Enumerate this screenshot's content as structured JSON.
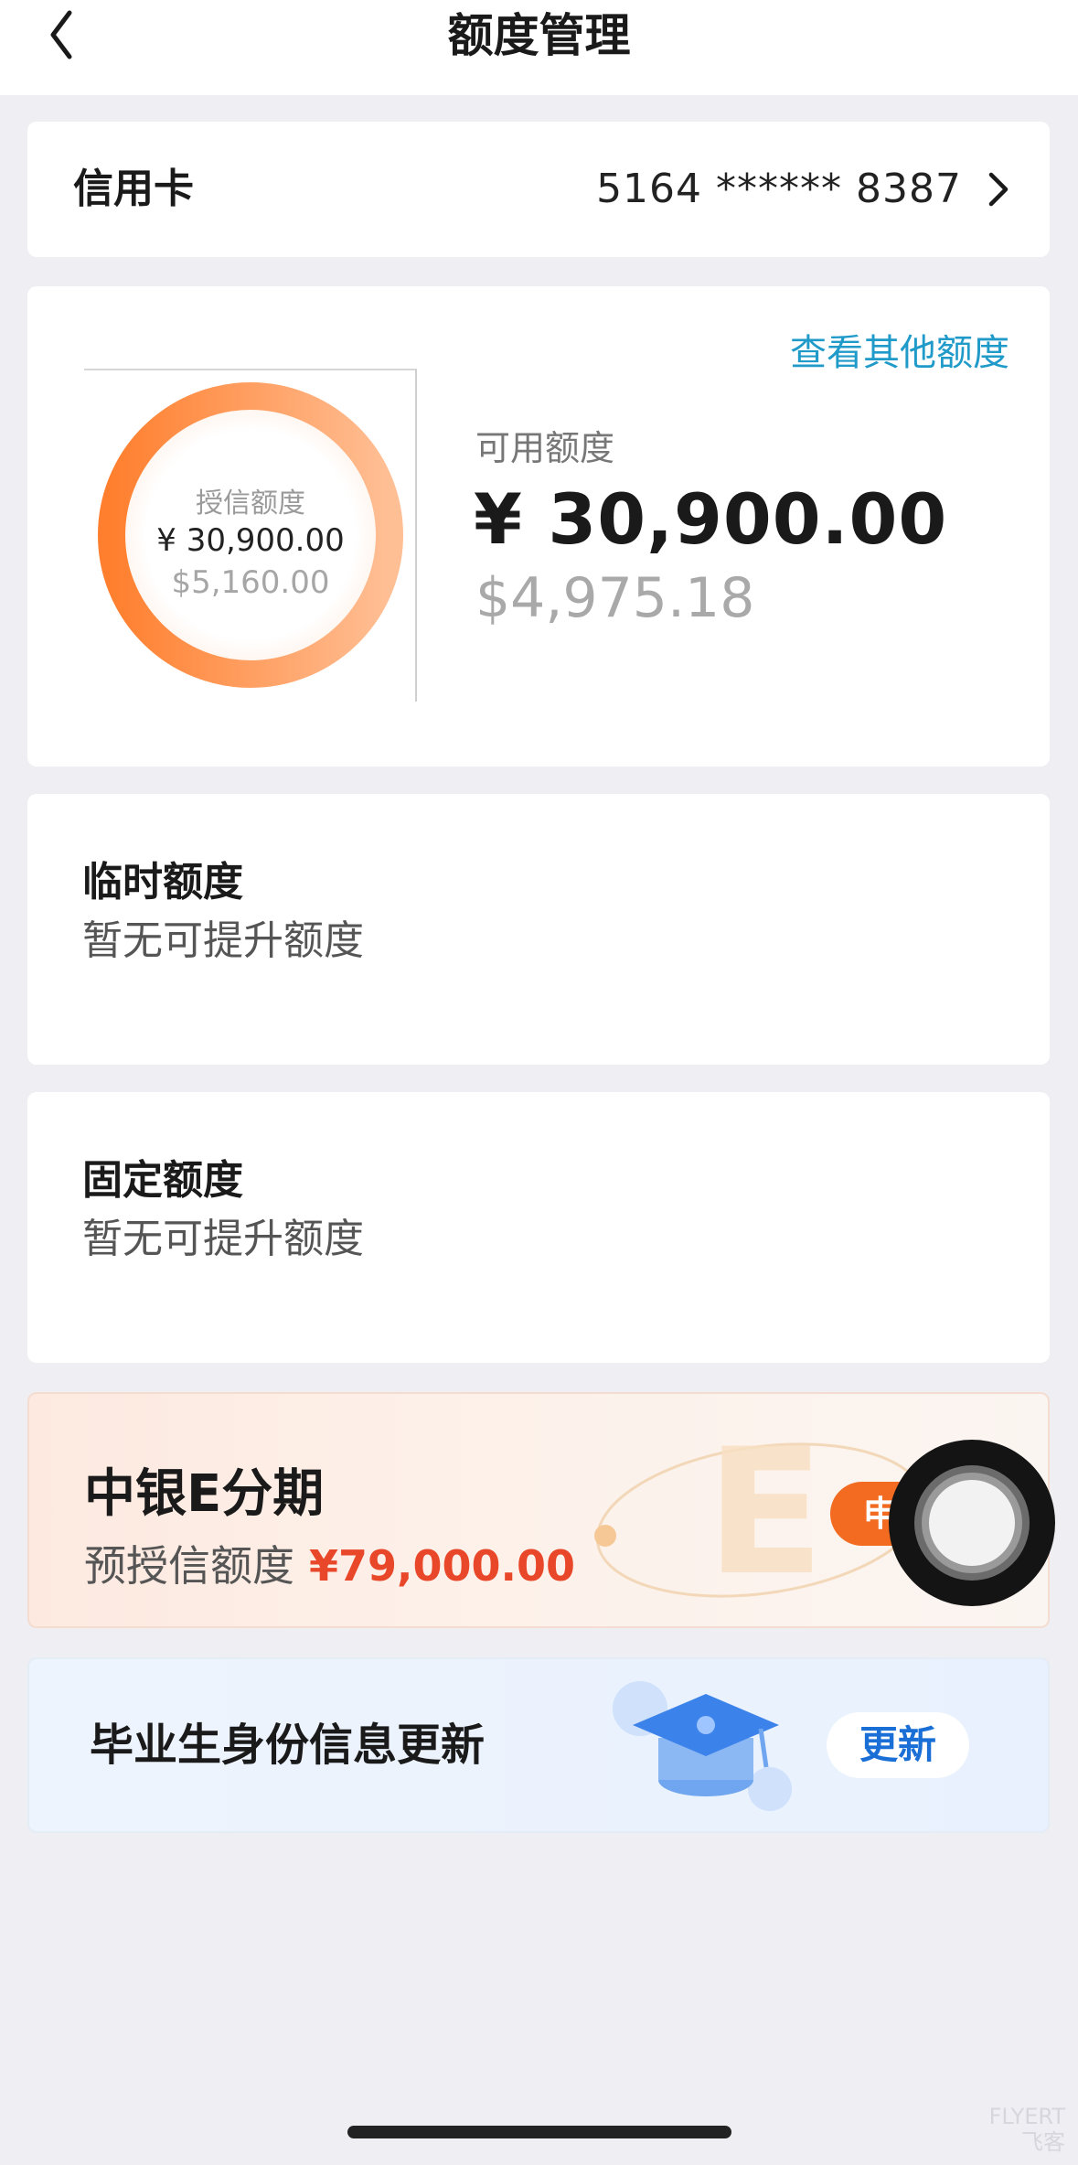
{
  "header": {
    "title": "额度管理",
    "back_icon": "chevron-left-icon"
  },
  "credit_card": {
    "label": "信用卡",
    "number": "5164 ****** 8387",
    "chevron_icon": "chevron-right-icon"
  },
  "quota": {
    "other_link": "查看其他额度",
    "ring": {
      "label": "授信额度",
      "cny": "¥ 30,900.00",
      "usd": "$5,160.00"
    },
    "available_label": "可用额度",
    "available_cny": "¥ 30,900.00",
    "available_usd": "$4,975.18"
  },
  "temporary": {
    "title": "临时额度",
    "status": "暂无可提升额度"
  },
  "fixed": {
    "title": "固定额度",
    "status": "暂无可提升额度"
  },
  "promo": {
    "title": "中银E分期",
    "sub_label": "预授信额度",
    "amount": "¥79,000.00",
    "button_label": "申"
  },
  "graduate": {
    "title": "毕业生身份信息更新",
    "button_label": "更新",
    "icon": "graduation-cap-icon"
  },
  "watermark": {
    "line1": "FLYERT",
    "line2": "飞客"
  },
  "colors": {
    "accent_blue": "#1f9ac9",
    "promo_orange": "#f26b21",
    "amount_red": "#e8472a",
    "ring_orange": "#ff8a3d"
  }
}
